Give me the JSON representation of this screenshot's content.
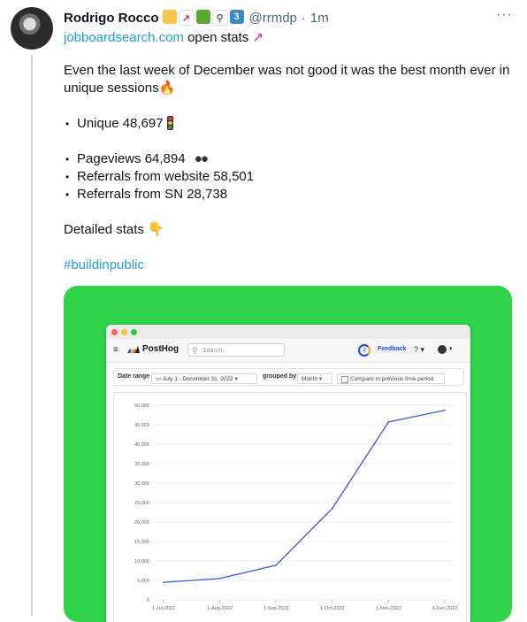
{
  "tweet": {
    "author_name": "Rodrigo Rocco",
    "handle": "@rrmdp",
    "time": "1m",
    "separator": "·",
    "more_label": "···",
    "link_text": "jobboardsearch.com",
    "subline_text": " open stats ",
    "intro": "Even the last week of December was not good it was the best month ever in unique sessions",
    "bullet1": "Unique 48,697",
    "bullets2": [
      "Pageviews 64,894",
      "Referrals from website 58,501",
      "Referrals from SN 28,738"
    ],
    "detailed": "Detailed stats",
    "hashtag": "#buildinpublic"
  },
  "app": {
    "logo_text": "PostHog",
    "search_placeholder": "Search...",
    "ring_count": "3",
    "feedback_label": "Feedback",
    "help_icon": "?",
    "date_range_label": "Date range",
    "date_range_value": "July 1 - December 31, 2022",
    "grouped_by_label": "grouped by",
    "grouped_by_value": "Month",
    "compare_label": "Compare to previous time period",
    "colors": {
      "accent": "#1d4aff",
      "media_bg": "#2fd44a"
    }
  },
  "chart_data": {
    "type": "line",
    "categories": [
      "1-Jul-2022",
      "1-Aug-2022",
      "1-Sep-2022",
      "1-Oct-2022",
      "1-Nov-2022",
      "1-Dec-2022"
    ],
    "values": [
      4500,
      5500,
      8900,
      23500,
      45700,
      48700
    ],
    "yticks": [
      "0",
      "5,000",
      "10,000",
      "15,000",
      "20,000",
      "25,000",
      "30,000",
      "35,000",
      "40,000",
      "45,000",
      "50,000"
    ],
    "ylim": [
      0,
      50000
    ],
    "color": "#1d4aff",
    "grid": true
  }
}
